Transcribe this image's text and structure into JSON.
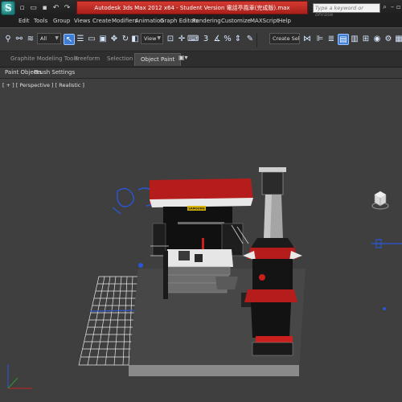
{
  "window": {
    "title": "Autodesk 3ds Max  2012 x64  -  Student Version  電話亭風車(完成版).max",
    "search_placeholder": "Type a keyword or phrase"
  },
  "quick_access": [
    "new-icon",
    "open-icon",
    "save-icon",
    "undo-icon",
    "redo-icon",
    "project-icon"
  ],
  "menu": [
    "Edit",
    "Tools",
    "Group",
    "Views",
    "Create",
    "Modifiers",
    "Animation",
    "Graph Editors",
    "Rendering",
    "Customize",
    "MAXScript",
    "Help"
  ],
  "toolbar": {
    "selection_filter": "All",
    "reference_coord": "View",
    "named_selection": "Create Selection Se"
  },
  "ribbon": {
    "tabs": [
      "Graphite Modeling Tools",
      "Freeform",
      "Selection",
      "Object Paint"
    ],
    "active_tab": "Object Paint",
    "panel_items": [
      "Paint Objects",
      "Brush Settings"
    ]
  },
  "viewport": {
    "label": "[ + ] [ Perspective ] [ Realistic ]",
    "sign_text": "SAMSUNG"
  },
  "colors": {
    "title_red": "#c62d26",
    "active_tool_blue": "#3d7dd6",
    "roof_red": "#b51d1d",
    "viewport_bg": "#3f3f3f"
  }
}
